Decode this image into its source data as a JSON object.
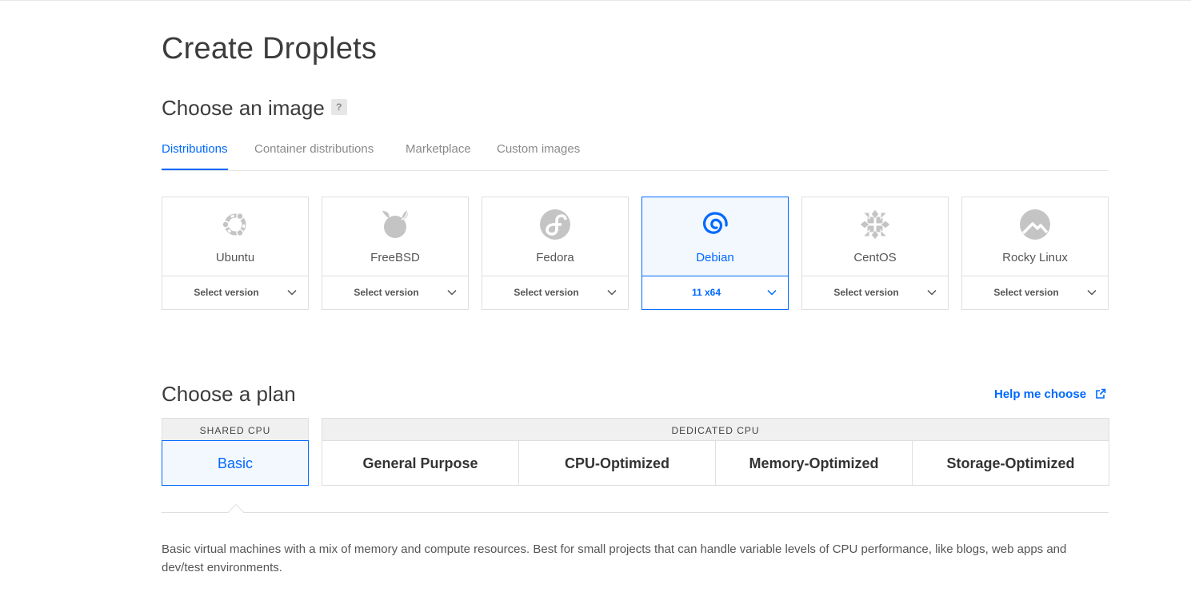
{
  "page": {
    "title": "Create Droplets"
  },
  "image_section": {
    "title": "Choose an image",
    "help_badge": "?",
    "tabs": [
      {
        "label": "Distributions",
        "active": true
      },
      {
        "label": "Container distributions",
        "active": false
      },
      {
        "label": "Marketplace",
        "active": false
      },
      {
        "label": "Custom images",
        "active": false
      }
    ],
    "distributions": [
      {
        "name": "Ubuntu",
        "version": "Select version",
        "icon": "ubuntu-logo-icon",
        "selected": false
      },
      {
        "name": "FreeBSD",
        "version": "Select version",
        "icon": "freebsd-logo-icon",
        "selected": false
      },
      {
        "name": "Fedora",
        "version": "Select version",
        "icon": "fedora-logo-icon",
        "selected": false
      },
      {
        "name": "Debian",
        "version": "11 x64",
        "icon": "debian-logo-icon",
        "selected": true
      },
      {
        "name": "CentOS",
        "version": "Select version",
        "icon": "centos-logo-icon",
        "selected": false
      },
      {
        "name": "Rocky Linux",
        "version": "Select version",
        "icon": "rocky-linux-logo-icon",
        "selected": false
      }
    ]
  },
  "plan_section": {
    "title": "Choose a plan",
    "help_link": "Help me choose",
    "groups": {
      "shared": "SHARED CPU",
      "dedicated": "DEDICATED CPU"
    },
    "options": [
      {
        "label": "Basic",
        "selected": true
      },
      {
        "label": "General Purpose",
        "selected": false
      },
      {
        "label": "CPU-Optimized",
        "selected": false
      },
      {
        "label": "Memory-Optimized",
        "selected": false
      },
      {
        "label": "Storage-Optimized",
        "selected": false
      }
    ],
    "description": "Basic virtual machines with a mix of memory and compute resources. Best for small projects that can handle variable levels of CPU performance, like blogs, web apps and dev/test environments."
  },
  "colors": {
    "accent": "#0069ff",
    "muted_icon": "#c4c4c4",
    "border": "#dfdfdf"
  }
}
